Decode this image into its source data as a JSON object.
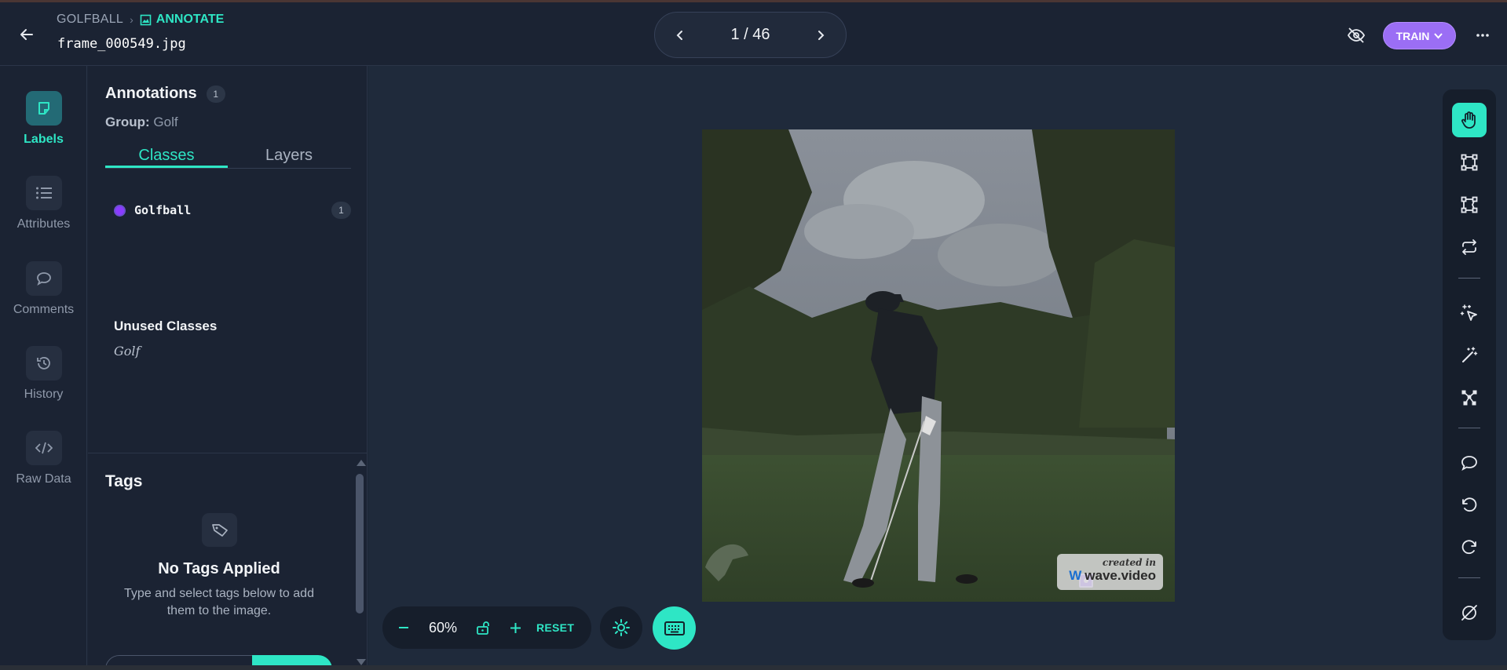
{
  "header": {
    "project": "GOLFBALL",
    "mode": "ANNOTATE",
    "filename": "frame_000549.jpg",
    "pager": "1 / 46",
    "train_label": "TRAIN"
  },
  "leftnav": {
    "items": [
      {
        "label": "Labels",
        "icon": "sticky-note-icon",
        "active": true
      },
      {
        "label": "Attributes",
        "icon": "list-icon"
      },
      {
        "label": "Comments",
        "icon": "comment-icon"
      },
      {
        "label": "History",
        "icon": "history-icon"
      },
      {
        "label": "Raw Data",
        "icon": "code-icon"
      }
    ]
  },
  "panel": {
    "title": "Annotations",
    "count": "1",
    "group_label": "Group:",
    "group_value": "Golf",
    "tabs": [
      "Classes",
      "Layers"
    ],
    "classes": [
      {
        "name": "Golfball",
        "count": "1",
        "color": "#8b3bff"
      }
    ],
    "unused_title": "Unused Classes",
    "unused": [
      "Golf"
    ],
    "tags_title": "Tags",
    "no_tags": "No Tags Applied",
    "no_tags_desc": "Type and select tags below to add them to the image."
  },
  "canvas": {
    "zoom": "60%",
    "reset": "RESET",
    "watermark_line1": "created in",
    "watermark_line2": "wave.video"
  },
  "colors": {
    "accent": "#2ee6c5",
    "train": "#9b6ef5",
    "class_golfball": "#8b3bff"
  }
}
